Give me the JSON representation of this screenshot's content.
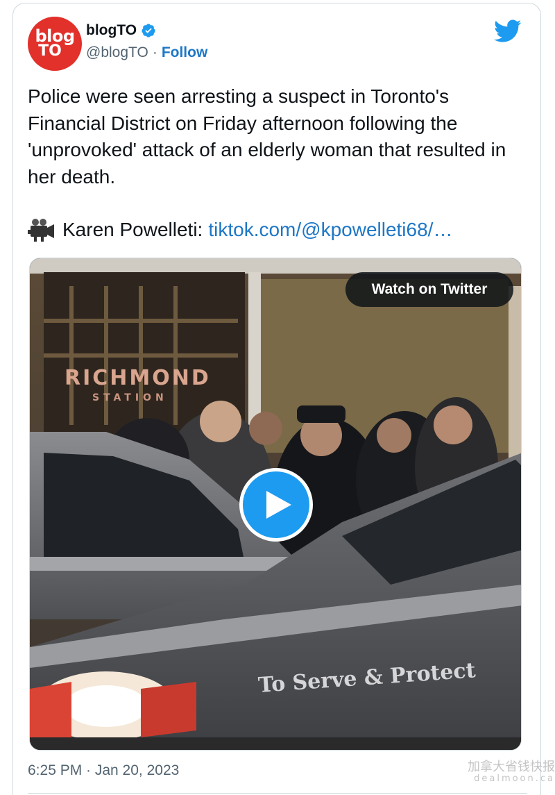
{
  "account": {
    "avatar_line1": "blog",
    "avatar_line2": "TO",
    "display_name": "blogTO",
    "handle": "@blogTO",
    "separator": "·",
    "follow_label": "Follow"
  },
  "tweet": {
    "text": "Police were seen arresting a suspect in Toronto's Financial District on Friday afternoon following the 'unprovoked' attack of an elderly woman that resulted in her death.",
    "source_credit": "Karen Powelleti:",
    "source_link": "tiktok.com/@kpowelleti68/…",
    "timestamp": "6:25 PM · Jan 20, 2023"
  },
  "media": {
    "watch_label": "Watch on Twitter",
    "scene_sign_main": "RICHMOND",
    "scene_sign_sub": "STATION",
    "scene_car_text": "To Serve & Protect"
  },
  "watermark": {
    "line1": "加拿大省钱快报",
    "line2": "dealmoon.ca"
  },
  "colors": {
    "brand_blue": "#1d9bf0",
    "link_blue": "#1d77c6",
    "avatar_red": "#e2302b"
  },
  "icons": {
    "verified": "verified-badge-icon",
    "twitter": "twitter-bird-icon",
    "camera": "movie-camera-icon",
    "play": "play-icon"
  }
}
